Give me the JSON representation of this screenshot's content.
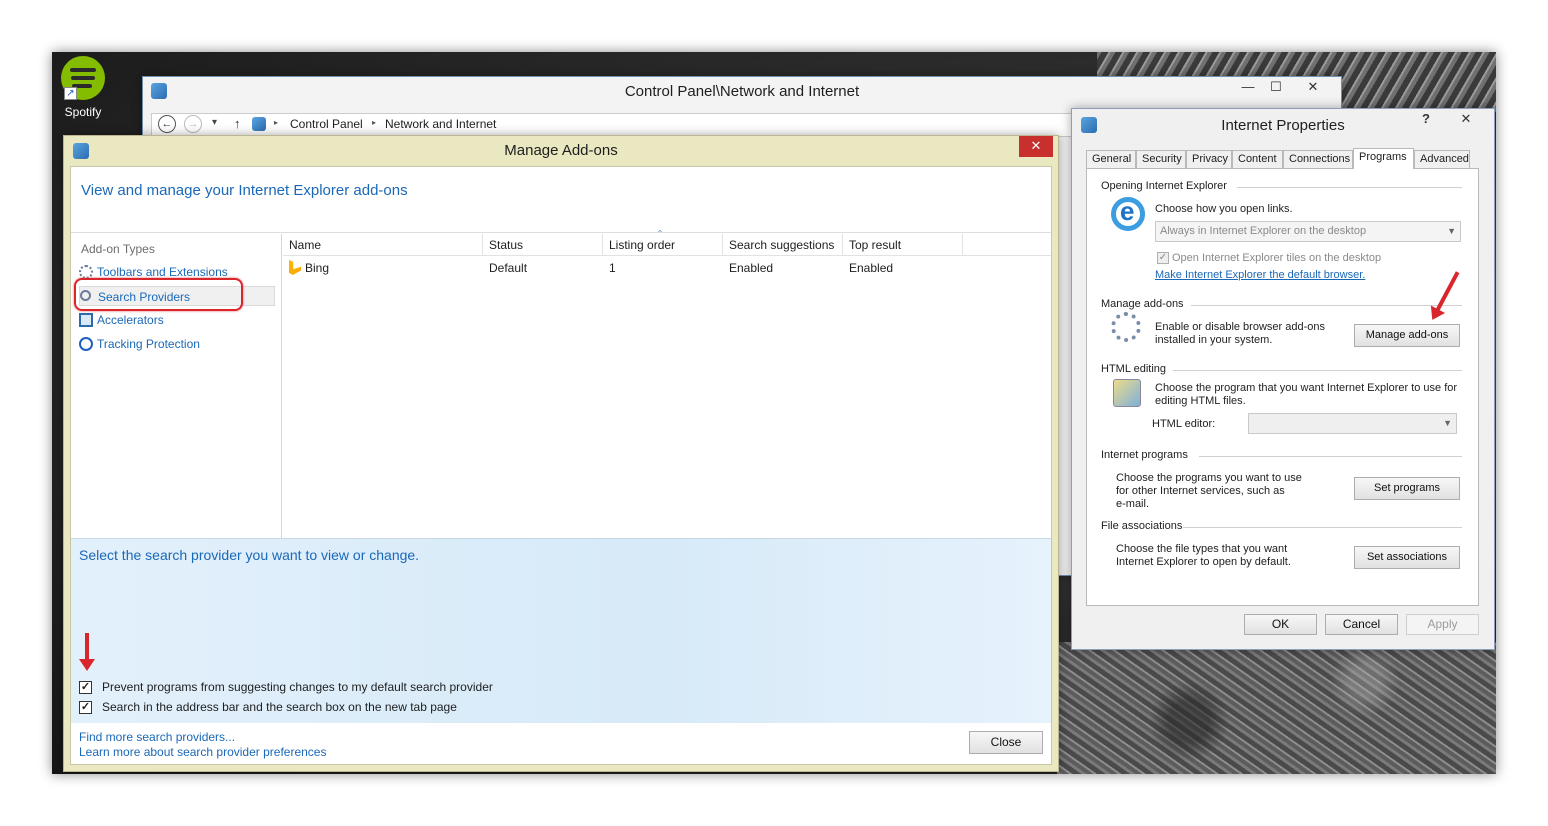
{
  "desktop": {
    "icon_label": "Spotify"
  },
  "control_panel": {
    "title": "Control Panel\\Network and Internet",
    "minimize": "—",
    "maximize": "☐",
    "close": "✕",
    "breadcrumb": [
      "Control Panel",
      "Network and Internet"
    ],
    "nav_back": "←",
    "nav_forward": "→",
    "nav_dropdown": "▾",
    "nav_up": "↑",
    "crumb_sep": "▸"
  },
  "manage_addons": {
    "title": "Manage Add-ons",
    "close": "✕",
    "header": "View and manage your Internet Explorer add-ons",
    "addon_types_heading": "Add-on Types",
    "addon_types": [
      "Toolbars and Extensions",
      "Search Providers",
      "Accelerators",
      "Tracking Protection"
    ],
    "columns": [
      "Name",
      "Status",
      "Listing order",
      "Search suggestions",
      "Top result"
    ],
    "sort_indicator": "ˆ",
    "rows": [
      {
        "name": "Bing",
        "status": "Default",
        "listing_order": "1",
        "search_suggestions": "Enabled",
        "top_result": "Enabled"
      }
    ],
    "details_text": "Select the search provider you want to view or change.",
    "checkboxes": [
      {
        "label": "Prevent programs from suggesting changes to my default search provider",
        "checked": true,
        "mark": "✓"
      },
      {
        "label": "Search in the address bar and the search box on the new tab page",
        "checked": true,
        "mark": "✓"
      }
    ],
    "links": [
      "Find more search providers...",
      "Learn more about search provider preferences"
    ],
    "close_button": "Close"
  },
  "internet_properties": {
    "title": "Internet Properties",
    "help": "?",
    "close": "✕",
    "tabs": [
      "General",
      "Security",
      "Privacy",
      "Content",
      "Connections",
      "Programs",
      "Advanced"
    ],
    "active_tab": "Programs",
    "opening": {
      "heading": "Opening Internet Explorer",
      "text": "Choose how you open links.",
      "combo_value": "Always in Internet Explorer on the desktop",
      "combo_arrow": "▼",
      "tiles_checkbox": "Open Internet Explorer tiles on the desktop",
      "tiles_mark": "✓",
      "default_link": "Make Internet Explorer the default browser."
    },
    "manage_addons": {
      "heading": "Manage add-ons",
      "text_line1": "Enable or disable browser add-ons",
      "text_line2": "installed in your system.",
      "button": "Manage add-ons"
    },
    "html_editing": {
      "heading": "HTML editing",
      "text_line1": "Choose the program that you want Internet Explorer to use for",
      "text_line2": "editing HTML files.",
      "editor_label": "HTML editor:",
      "editor_value": "",
      "editor_arrow": "▼"
    },
    "internet_programs": {
      "heading": "Internet programs",
      "text_line1": "Choose the programs you want to use",
      "text_line2": "for other Internet services, such as",
      "text_line3": "e-mail.",
      "button": "Set programs"
    },
    "file_associations": {
      "heading": "File associations",
      "text_line1": "Choose the file types that you want",
      "text_line2": "Internet Explorer to open by default.",
      "button": "Set associations"
    },
    "buttons": {
      "ok": "OK",
      "cancel": "Cancel",
      "apply": "Apply"
    }
  },
  "colors": {
    "highlight_red": "#d9262c",
    "link_blue": "#1a68b8",
    "addons_frame": "#e9e8c1"
  }
}
